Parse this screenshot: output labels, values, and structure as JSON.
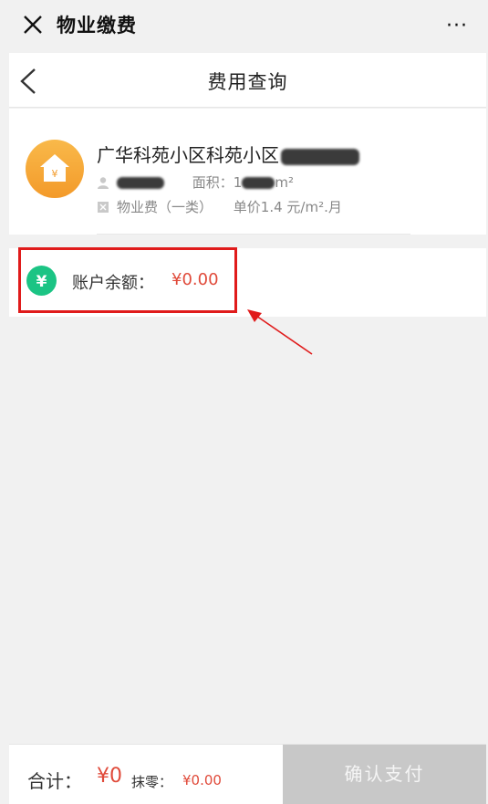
{
  "topbar": {
    "title": "物业缴费",
    "more": "···"
  },
  "navbar": {
    "title": "费用查询"
  },
  "house": {
    "name": "广华科苑小区科苑小区",
    "area_label": "面积：",
    "area_prefix": "1",
    "area_unit": "m²",
    "fee_type": "物业费（一类）",
    "unit_price": "单价1.4 元/m².月",
    "avatar_symbol": "¥"
  },
  "balance": {
    "symbol": "¥",
    "label": "账户余额：",
    "amount": "¥0.00"
  },
  "footer": {
    "total_label": "合计：",
    "total_value": "¥0",
    "rounding_label": "抹零：",
    "rounding_value": "¥0.00",
    "pay_label": "确认支付"
  },
  "colors": {
    "accent_red": "#e04a3a",
    "balance_green": "#1bc484",
    "avatar_orange": "#f5a623",
    "highlight_red": "#e01b1b",
    "pay_disabled": "#c8c8c8"
  }
}
